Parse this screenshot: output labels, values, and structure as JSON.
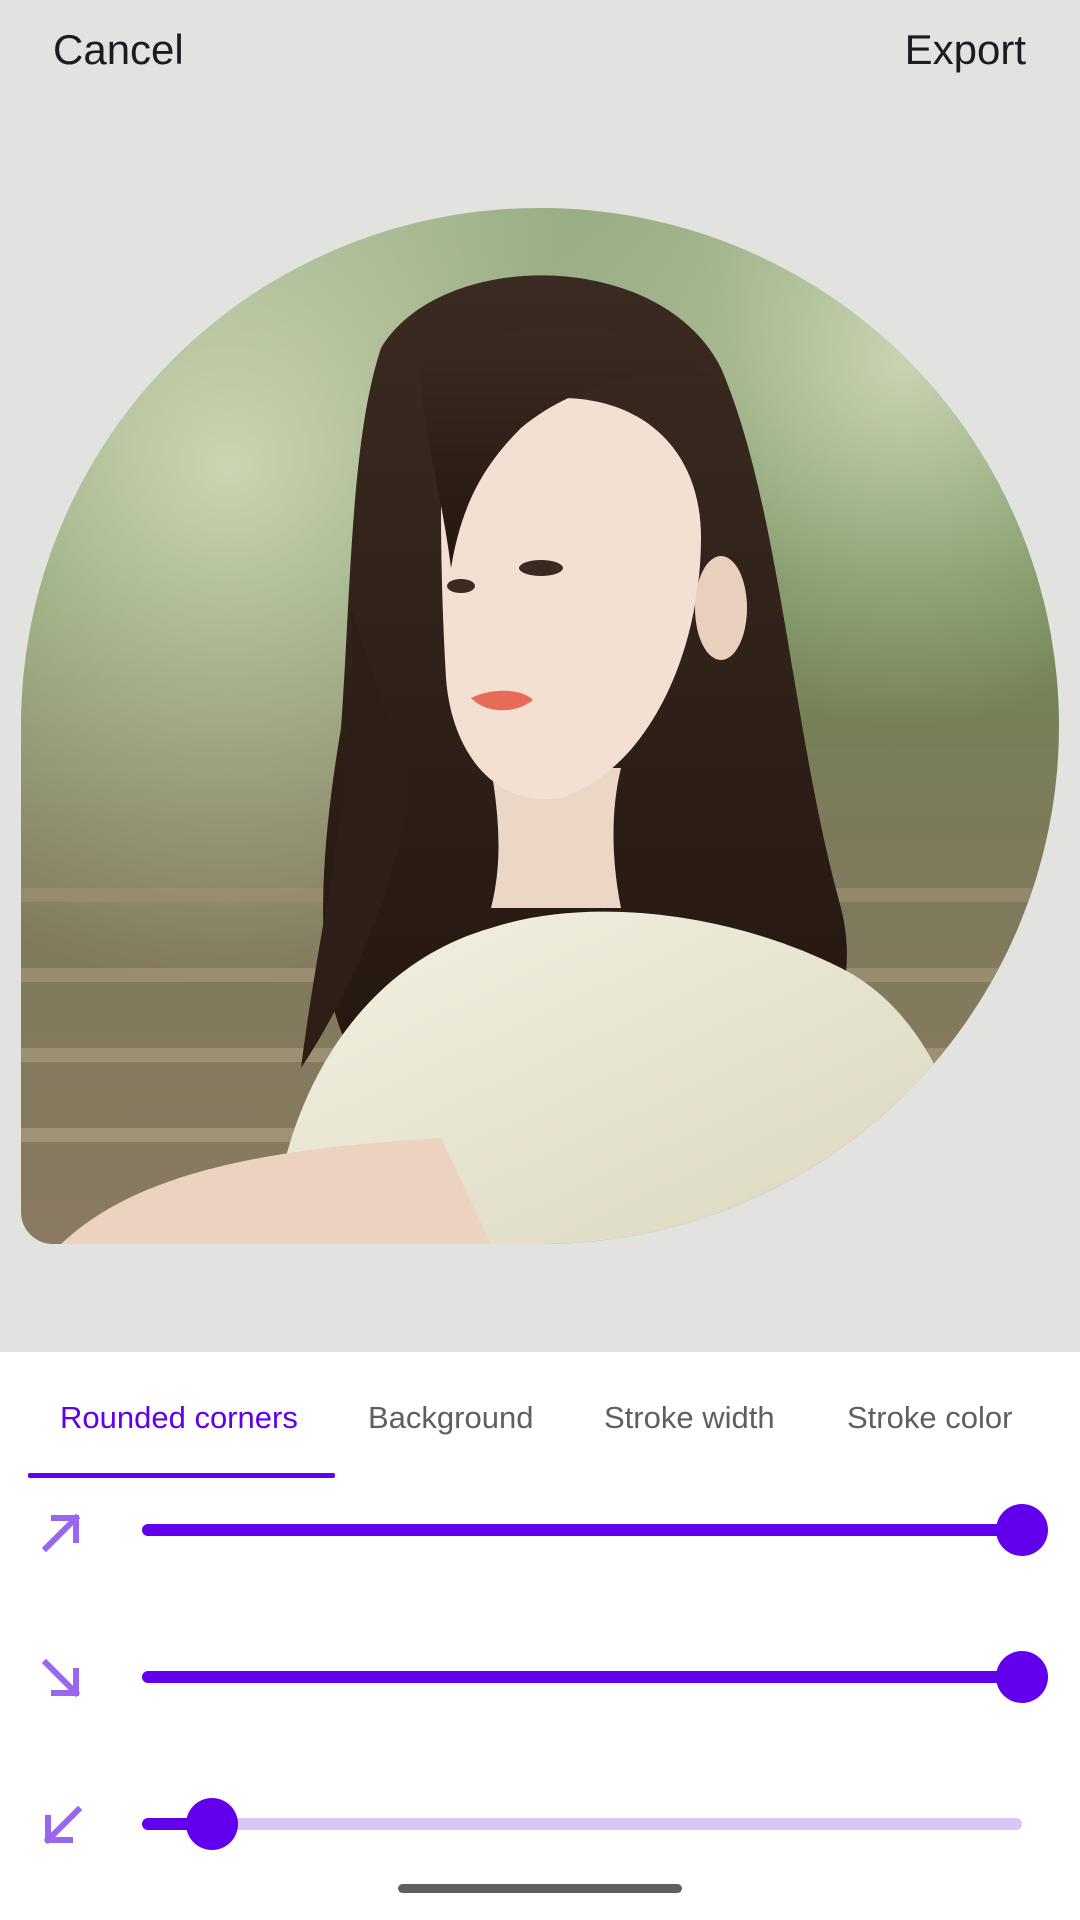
{
  "top_bar": {
    "cancel_label": "Cancel",
    "export_label": "Export"
  },
  "tabs": [
    {
      "label": "Rounded corners",
      "active": true
    },
    {
      "label": "Background",
      "active": false
    },
    {
      "label": "Stroke width",
      "active": false
    },
    {
      "label": "Stroke color",
      "active": false
    }
  ],
  "sliders": [
    {
      "icon": "arrow-up-right-icon",
      "value": 1.0
    },
    {
      "icon": "arrow-down-right-icon",
      "value": 1.0
    },
    {
      "icon": "arrow-down-left-icon",
      "value": 0.08
    }
  ],
  "colors": {
    "accent": "#6200ee",
    "track_inactive": "#d7c6f7",
    "icon": "#9966f0",
    "canvas_bg": "#e2e2e0",
    "panel_bg": "#ffffff",
    "tab_inactive": "#5f5e63"
  }
}
